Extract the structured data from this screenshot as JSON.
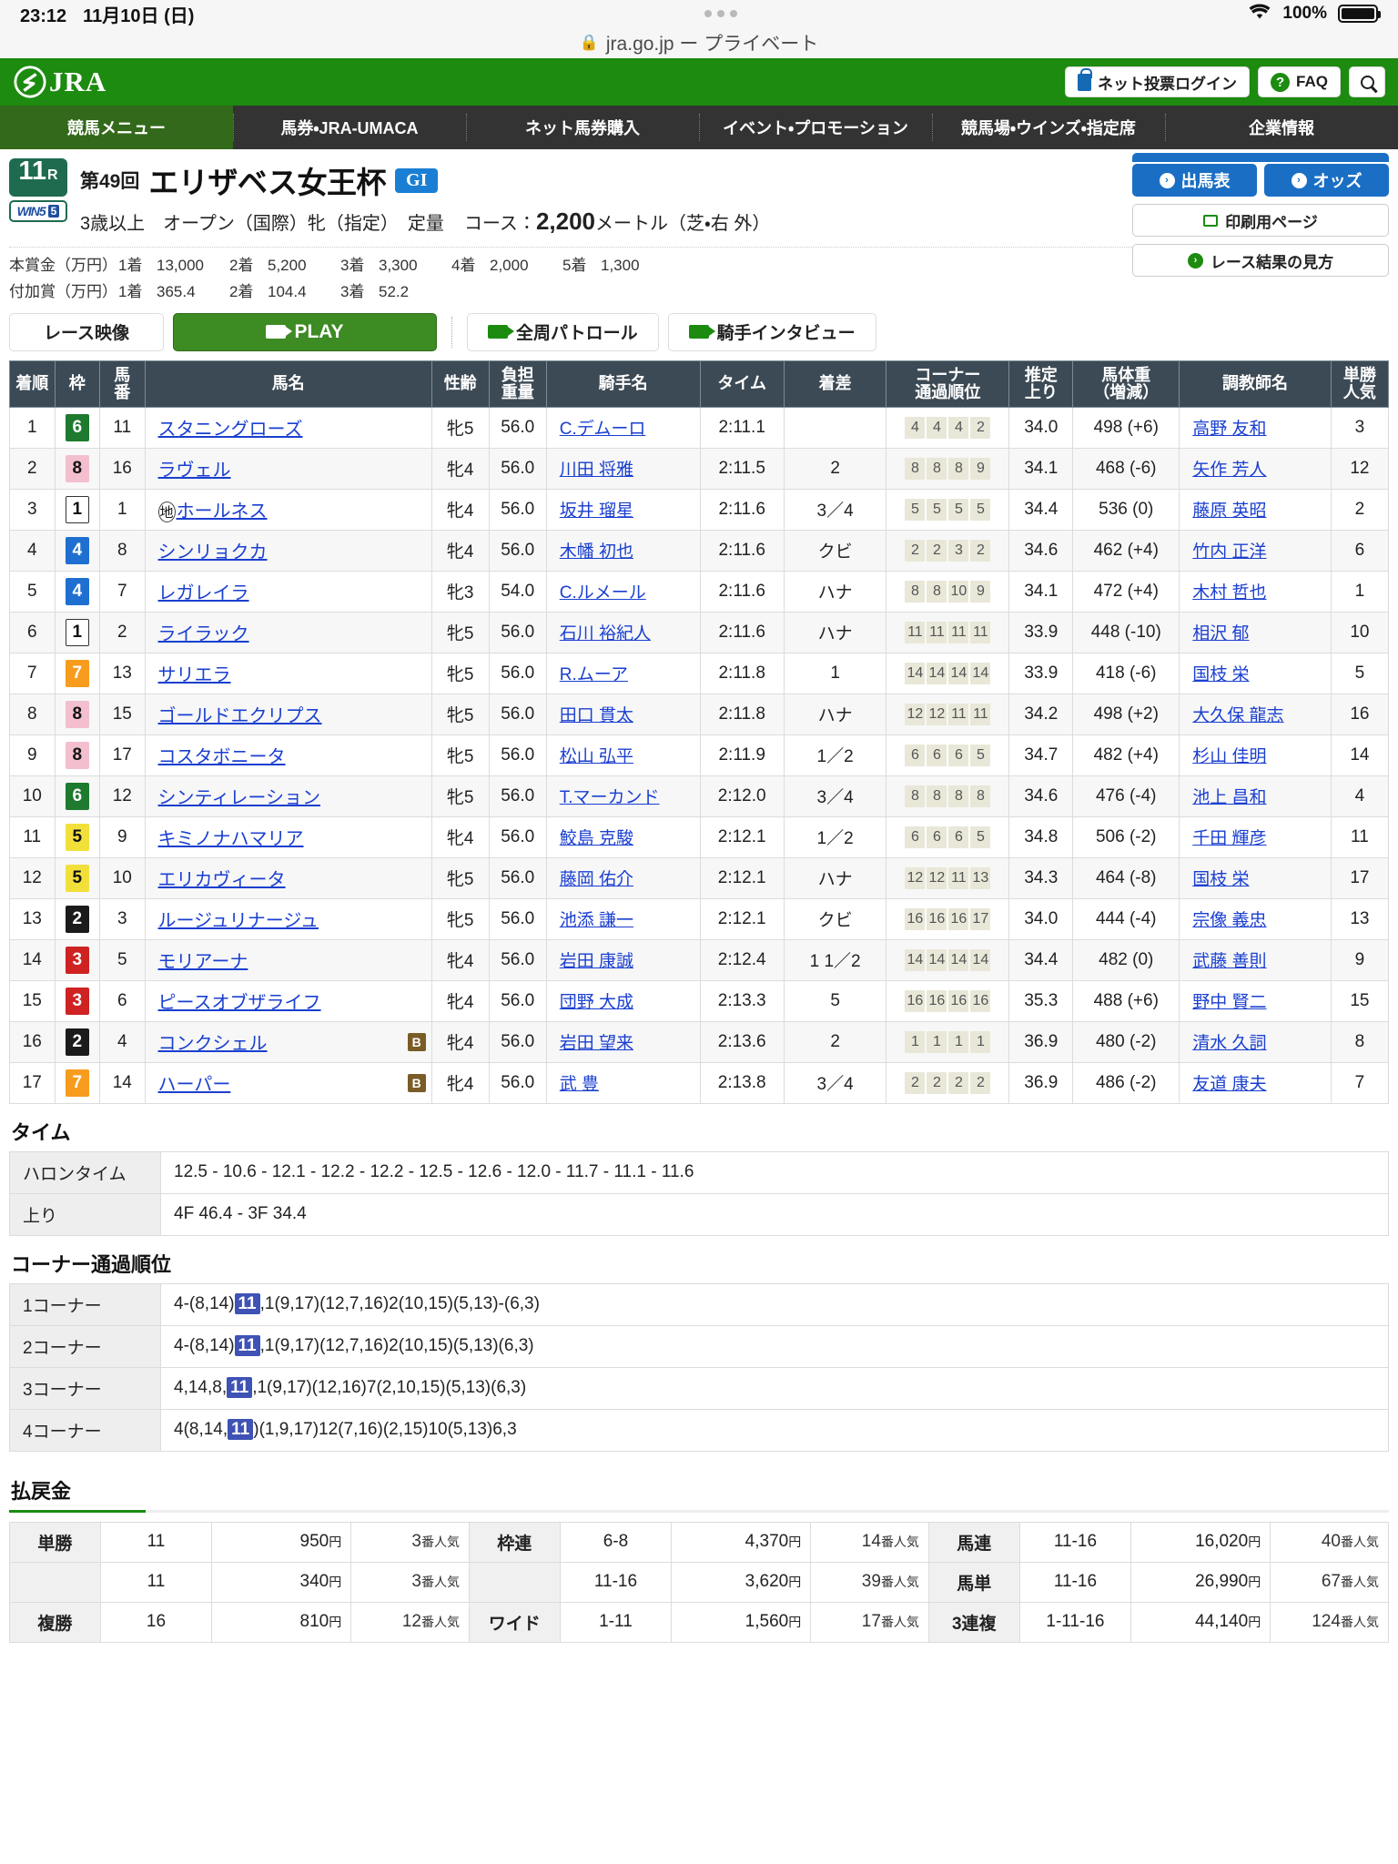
{
  "status_bar": {
    "time": "23:12",
    "date": "11月10日 (日)",
    "battery": "100%",
    "wifi_icon": "wifi-icon",
    "battery_icon": "battery-icon"
  },
  "browser": {
    "lock_icon": "lock-icon",
    "url": "jra.go.jp ー プライベート"
  },
  "header": {
    "logo": "JRA",
    "login_button": "ネット投票ログイン",
    "faq_button": "FAQ",
    "faq_mark": "?",
    "search_icon": "search-icon"
  },
  "nav": {
    "items": [
      "競馬メニュー",
      "馬券・JRA-UMACA",
      "ネット馬券購入",
      "イベント・プロモーション",
      "競馬場・ウインズ・指定席",
      "企業情報"
    ],
    "active_index": 0
  },
  "race": {
    "race_number": "11",
    "race_number_suffix": "R",
    "win5_label": "WIN5",
    "win5_num": "5",
    "edition": "第49回",
    "name": "エリザベス女王杯",
    "grade": "GI",
    "conditions": "3歳以上　オープン（国際）牝（指定）　定量",
    "course_label": "コース：",
    "course_distance": "2,200",
    "course_unit": "メートル",
    "course_detail": "（芝・右 外）",
    "prize_main_label": "本賞金（万円）",
    "prize_main": [
      {
        "pos": "1着",
        "amt": "13,000"
      },
      {
        "pos": "2着",
        "amt": "5,200"
      },
      {
        "pos": "3着",
        "amt": "3,300"
      },
      {
        "pos": "4着",
        "amt": "2,000"
      },
      {
        "pos": "5着",
        "amt": "1,300"
      }
    ],
    "prize_extra_label": "付加賞（万円）",
    "prize_extra": [
      {
        "pos": "1着",
        "amt": "365.4"
      },
      {
        "pos": "2着",
        "amt": "104.4"
      },
      {
        "pos": "3着",
        "amt": "52.2"
      }
    ]
  },
  "side_buttons": {
    "entry_table": "出馬表",
    "odds": "オッズ",
    "print_page": "印刷用ページ",
    "how_to_read": "レース結果の見方"
  },
  "movie": {
    "label": "レース映像",
    "play": "PLAY",
    "patrol": "全周パトロール",
    "interview": "騎手インタビュー"
  },
  "results_table": {
    "headers": [
      "着順",
      "枠",
      "馬番",
      "馬名",
      "性齢",
      "負担\n重量",
      "騎手名",
      "タイム",
      "着差",
      "コーナー\n通過順位",
      "推定\n上り",
      "馬体重\n（増減）",
      "調教師名",
      "単勝\n人気"
    ],
    "rows": [
      {
        "rank": "1",
        "waku": "6",
        "umaban": "11",
        "horse": "スタニングローズ",
        "blinker": false,
        "prefix": "",
        "sex_age": "牝5",
        "weight": "56.0",
        "jockey": "C.デムーロ",
        "time": "2:11.1",
        "margin": "",
        "corners": [
          "4",
          "4",
          "4",
          "2"
        ],
        "agari": "34.0",
        "bataiju": "498 (+6)",
        "trainer": "高野 友和",
        "pop": "3"
      },
      {
        "rank": "2",
        "waku": "8",
        "umaban": "16",
        "horse": "ラヴェル",
        "blinker": false,
        "prefix": "",
        "sex_age": "牝4",
        "weight": "56.0",
        "jockey": "川田 将雅",
        "time": "2:11.5",
        "margin": "2",
        "corners": [
          "8",
          "8",
          "8",
          "9"
        ],
        "agari": "34.1",
        "bataiju": "468 (-6)",
        "trainer": "矢作 芳人",
        "pop": "12"
      },
      {
        "rank": "3",
        "waku": "1",
        "umaban": "1",
        "horse": "ホールネス",
        "blinker": false,
        "prefix": "地",
        "sex_age": "牝4",
        "weight": "56.0",
        "jockey": "坂井 瑠星",
        "time": "2:11.6",
        "margin": "3／4",
        "corners": [
          "5",
          "5",
          "5",
          "5"
        ],
        "agari": "34.4",
        "bataiju": "536 (0)",
        "trainer": "藤原 英昭",
        "pop": "2"
      },
      {
        "rank": "4",
        "waku": "4",
        "umaban": "8",
        "horse": "シンリョクカ",
        "blinker": false,
        "prefix": "",
        "sex_age": "牝4",
        "weight": "56.0",
        "jockey": "木幡 初也",
        "time": "2:11.6",
        "margin": "クビ",
        "corners": [
          "2",
          "2",
          "3",
          "2"
        ],
        "agari": "34.6",
        "bataiju": "462 (+4)",
        "trainer": "竹内 正洋",
        "pop": "6"
      },
      {
        "rank": "5",
        "waku": "4",
        "umaban": "7",
        "horse": "レガレイラ",
        "blinker": false,
        "prefix": "",
        "sex_age": "牝3",
        "weight": "54.0",
        "jockey": "C.ルメール",
        "time": "2:11.6",
        "margin": "ハナ",
        "corners": [
          "8",
          "8",
          "10",
          "9"
        ],
        "agari": "34.1",
        "bataiju": "472 (+4)",
        "trainer": "木村 哲也",
        "pop": "1"
      },
      {
        "rank": "6",
        "waku": "1",
        "umaban": "2",
        "horse": "ライラック",
        "blinker": false,
        "prefix": "",
        "sex_age": "牝5",
        "weight": "56.0",
        "jockey": "石川 裕紀人",
        "time": "2:11.6",
        "margin": "ハナ",
        "corners": [
          "11",
          "11",
          "11",
          "11"
        ],
        "agari": "33.9",
        "bataiju": "448 (-10)",
        "trainer": "相沢 郁",
        "pop": "10"
      },
      {
        "rank": "7",
        "waku": "7",
        "umaban": "13",
        "horse": "サリエラ",
        "blinker": false,
        "prefix": "",
        "sex_age": "牝5",
        "weight": "56.0",
        "jockey": "R.ムーア",
        "time": "2:11.8",
        "margin": "1",
        "corners": [
          "14",
          "14",
          "14",
          "14"
        ],
        "agari": "33.9",
        "bataiju": "418 (-6)",
        "trainer": "国枝 栄",
        "pop": "5"
      },
      {
        "rank": "8",
        "waku": "8",
        "umaban": "15",
        "horse": "ゴールドエクリプス",
        "blinker": false,
        "prefix": "",
        "sex_age": "牝5",
        "weight": "56.0",
        "jockey": "田口 貫太",
        "time": "2:11.8",
        "margin": "ハナ",
        "corners": [
          "12",
          "12",
          "11",
          "11"
        ],
        "agari": "34.2",
        "bataiju": "498 (+2)",
        "trainer": "大久保 龍志",
        "pop": "16"
      },
      {
        "rank": "9",
        "waku": "8",
        "umaban": "17",
        "horse": "コスタボニータ",
        "blinker": false,
        "prefix": "",
        "sex_age": "牝5",
        "weight": "56.0",
        "jockey": "松山 弘平",
        "time": "2:11.9",
        "margin": "1／2",
        "corners": [
          "6",
          "6",
          "6",
          "5"
        ],
        "agari": "34.7",
        "bataiju": "482 (+4)",
        "trainer": "杉山 佳明",
        "pop": "14"
      },
      {
        "rank": "10",
        "waku": "6",
        "umaban": "12",
        "horse": "シンティレーション",
        "blinker": false,
        "prefix": "",
        "sex_age": "牝5",
        "weight": "56.0",
        "jockey": "T.マーカンド",
        "time": "2:12.0",
        "margin": "3／4",
        "corners": [
          "8",
          "8",
          "8",
          "8"
        ],
        "agari": "34.6",
        "bataiju": "476 (-4)",
        "trainer": "池上 昌和",
        "pop": "4"
      },
      {
        "rank": "11",
        "waku": "5",
        "umaban": "9",
        "horse": "キミノナハマリア",
        "blinker": false,
        "prefix": "",
        "sex_age": "牝4",
        "weight": "56.0",
        "jockey": "鮫島 克駿",
        "time": "2:12.1",
        "margin": "1／2",
        "corners": [
          "6",
          "6",
          "6",
          "5"
        ],
        "agari": "34.8",
        "bataiju": "506 (-2)",
        "trainer": "千田 輝彦",
        "pop": "11"
      },
      {
        "rank": "12",
        "waku": "5",
        "umaban": "10",
        "horse": "エリカヴィータ",
        "blinker": false,
        "prefix": "",
        "sex_age": "牝5",
        "weight": "56.0",
        "jockey": "藤岡 佑介",
        "time": "2:12.1",
        "margin": "ハナ",
        "corners": [
          "12",
          "12",
          "11",
          "13"
        ],
        "agari": "34.3",
        "bataiju": "464 (-8)",
        "trainer": "国枝 栄",
        "pop": "17"
      },
      {
        "rank": "13",
        "waku": "2",
        "umaban": "3",
        "horse": "ルージュリナージュ",
        "blinker": false,
        "prefix": "",
        "sex_age": "牝5",
        "weight": "56.0",
        "jockey": "池添 謙一",
        "time": "2:12.1",
        "margin": "クビ",
        "corners": [
          "16",
          "16",
          "16",
          "17"
        ],
        "agari": "34.0",
        "bataiju": "444 (-4)",
        "trainer": "宗像 義忠",
        "pop": "13"
      },
      {
        "rank": "14",
        "waku": "3",
        "umaban": "5",
        "horse": "モリアーナ",
        "blinker": false,
        "prefix": "",
        "sex_age": "牝4",
        "weight": "56.0",
        "jockey": "岩田 康誠",
        "time": "2:12.4",
        "margin": "1 1／2",
        "corners": [
          "14",
          "14",
          "14",
          "14"
        ],
        "agari": "34.4",
        "bataiju": "482 (0)",
        "trainer": "武藤 善則",
        "pop": "9"
      },
      {
        "rank": "15",
        "waku": "3",
        "umaban": "6",
        "horse": "ピースオブザライフ",
        "blinker": false,
        "prefix": "",
        "sex_age": "牝4",
        "weight": "56.0",
        "jockey": "団野 大成",
        "time": "2:13.3",
        "margin": "5",
        "corners": [
          "16",
          "16",
          "16",
          "16"
        ],
        "agari": "35.3",
        "bataiju": "488 (+6)",
        "trainer": "野中 賢二",
        "pop": "15"
      },
      {
        "rank": "16",
        "waku": "2",
        "umaban": "4",
        "horse": "コンクシェル",
        "blinker": true,
        "prefix": "",
        "sex_age": "牝4",
        "weight": "56.0",
        "jockey": "岩田 望来",
        "time": "2:13.6",
        "margin": "2",
        "corners": [
          "1",
          "1",
          "1",
          "1"
        ],
        "agari": "36.9",
        "bataiju": "480 (-2)",
        "trainer": "清水 久詞",
        "pop": "8"
      },
      {
        "rank": "17",
        "waku": "7",
        "umaban": "14",
        "horse": "ハーパー",
        "blinker": true,
        "prefix": "",
        "sex_age": "牝4",
        "weight": "56.0",
        "jockey": "武 豊",
        "time": "2:13.8",
        "margin": "3／4",
        "corners": [
          "2",
          "2",
          "2",
          "2"
        ],
        "agari": "36.9",
        "bataiju": "486 (-2)",
        "trainer": "友道 康夫",
        "pop": "7"
      }
    ]
  },
  "time_section": {
    "title": "タイム",
    "rows": [
      {
        "label": "ハロンタイム",
        "value": "12.5 - 10.6 - 12.1 - 12.2 - 12.2 - 12.5 - 12.6 - 12.0 - 11.7 - 11.1 - 11.6"
      },
      {
        "label": "上り",
        "value": "4F 46.4 - 3F 34.4"
      }
    ]
  },
  "corner_section": {
    "title": "コーナー通過順位",
    "rows": [
      {
        "label": "1コーナー",
        "pre": "4-(8,14)",
        "hl": "11",
        "post": ",1(9,17)(12,7,16)2(10,15)(5,13)-(6,3)"
      },
      {
        "label": "2コーナー",
        "pre": "4-(8,14)",
        "hl": "11",
        "post": ",1(9,17)(12,7,16)2(10,15)(5,13)(6,3)"
      },
      {
        "label": "3コーナー",
        "pre": "4,14,8,",
        "hl": "11",
        "post": ",1(9,17)(12,16)7(2,10,15)(5,13)(6,3)"
      },
      {
        "label": "4コーナー",
        "pre": "4(8,14,",
        "hl": "11",
        "post": ")(1,9,17)12(7,16)(2,15)10(5,13)6,3"
      }
    ]
  },
  "payout_section": {
    "title": "払戻金",
    "yen": "円",
    "pop_suffix": "番人気",
    "rows": [
      {
        "left_label": "単勝",
        "left_num": "11",
        "left_yen": "950",
        "left_pop": "3",
        "mid_label": "枠連",
        "mid_num": "6-8",
        "mid_yen": "4,370",
        "mid_pop": "14",
        "right_label": "馬連",
        "right_num": "11-16",
        "right_yen": "16,020",
        "right_pop": "40"
      },
      {
        "left_label": "",
        "left_num": "11",
        "left_yen": "340",
        "left_pop": "3",
        "mid_label": "",
        "mid_num": "11-16",
        "mid_yen": "3,620",
        "mid_pop": "39",
        "right_label": "馬単",
        "right_num": "11-16",
        "right_yen": "26,990",
        "right_pop": "67"
      },
      {
        "left_label": "複勝",
        "left_num": "16",
        "left_yen": "810",
        "left_pop": "12",
        "mid_label": "ワイド",
        "mid_num": "1-11",
        "mid_yen": "1,560",
        "mid_pop": "17",
        "right_label": "3連複",
        "right_num": "1-11-16",
        "right_yen": "44,140",
        "right_pop": "124"
      }
    ]
  }
}
